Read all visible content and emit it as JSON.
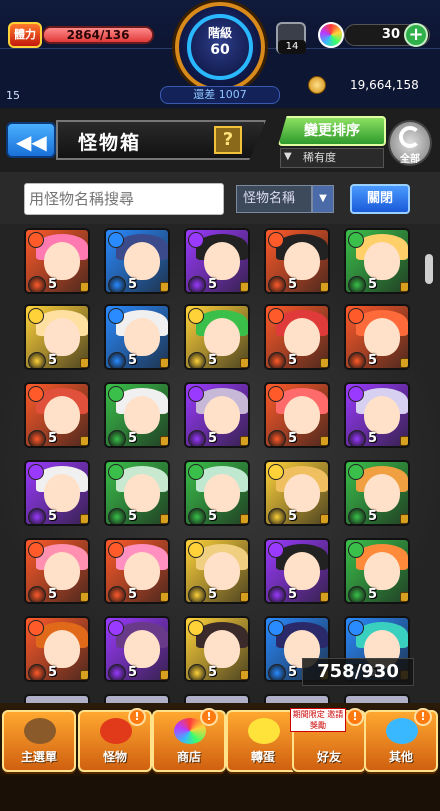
{
  "status": {
    "stamina_label": "體力",
    "stamina_value": "2864",
    "stamina_max": "/136",
    "stamina_fill_fraction": 1.0,
    "rank_label": "階級",
    "rank_value": "60",
    "exp_left_label": "還差 1007",
    "gift_count": "14",
    "orb_count": "30",
    "orb_plus": "+",
    "player_level": "15",
    "gold_count": "19,664,158"
  },
  "header": {
    "back": "◀◀",
    "title": "怪物箱",
    "help": "?",
    "sort_label": "變更排序",
    "sort_sub": "稀有度",
    "filter_icon": "▼",
    "all_label": "全部"
  },
  "search": {
    "placeholder": "用怪物名稱搜尋",
    "type": "怪物名稱",
    "type_arrow": "▼",
    "close": "關閉"
  },
  "colors": {
    "fire": "#ff5a2a",
    "water": "#2a8aff",
    "wood": "#3ac04a",
    "light": "#ffd23a",
    "dark": "#9a3aff"
  },
  "monsters": [
    {
      "level": "5",
      "element": "fire"
    },
    {
      "level": "5",
      "element": "water"
    },
    {
      "level": "5",
      "element": "dark"
    },
    {
      "level": "5",
      "element": "fire"
    },
    {
      "level": "5",
      "element": "wood"
    },
    {
      "level": "5",
      "element": "light"
    },
    {
      "level": "5",
      "element": "water"
    },
    {
      "level": "5",
      "element": "light"
    },
    {
      "level": "5",
      "element": "fire"
    },
    {
      "level": "5",
      "element": "fire"
    },
    {
      "level": "5",
      "element": "fire"
    },
    {
      "level": "5",
      "element": "wood"
    },
    {
      "level": "5",
      "element": "dark"
    },
    {
      "level": "5",
      "element": "fire"
    },
    {
      "level": "5",
      "element": "dark"
    },
    {
      "level": "5",
      "element": "dark"
    },
    {
      "level": "5",
      "element": "wood"
    },
    {
      "level": "5",
      "element": "wood"
    },
    {
      "level": "5",
      "element": "light"
    },
    {
      "level": "5",
      "element": "wood"
    },
    {
      "level": "5",
      "element": "fire"
    },
    {
      "level": "5",
      "element": "fire"
    },
    {
      "level": "5",
      "element": "light"
    },
    {
      "level": "5",
      "element": "dark"
    },
    {
      "level": "5",
      "element": "wood"
    },
    {
      "level": "5",
      "element": "fire"
    },
    {
      "level": "5",
      "element": "dark"
    },
    {
      "level": "5",
      "element": "light"
    },
    {
      "level": "5",
      "element": "water"
    },
    {
      "level": "5",
      "element": "water"
    }
  ],
  "box_count": "758/930",
  "nav": {
    "main": "主選單",
    "monster": "怪物",
    "shop": "商店",
    "gacha": "轉蛋",
    "friend": "好友",
    "friend_tag": "期間限定 邀請獎勵",
    "other": "其他",
    "alert": "!"
  }
}
